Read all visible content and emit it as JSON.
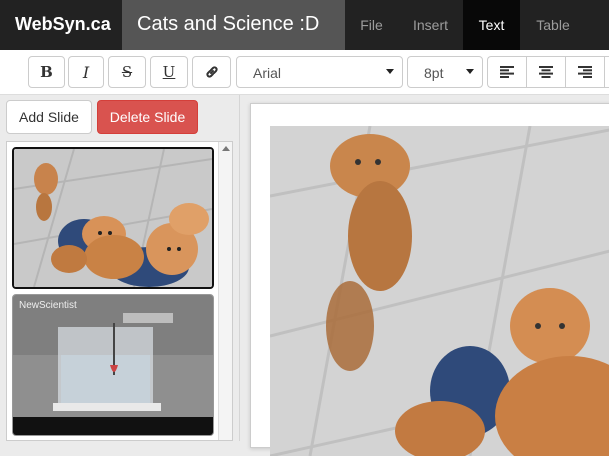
{
  "app": {
    "brand": "WebSyn.ca",
    "doc_title": "Cats and Science :D"
  },
  "menu": {
    "file": "File",
    "insert": "Insert",
    "text": "Text",
    "table": "Table"
  },
  "toolbar": {
    "bold": "B",
    "italic": "I",
    "strike": "S",
    "underline": "U",
    "font_family": "Arial",
    "font_size": "8pt"
  },
  "sidebar": {
    "add_slide": "Add Slide",
    "delete_slide": "Delete Slide",
    "slides": [
      {
        "kind": "photo-kittens"
      },
      {
        "kind": "photo-lab",
        "watermark": "NewScientist"
      }
    ]
  },
  "colors": {
    "topbar": "#222222",
    "active_menu": "#080808",
    "title_bg": "#555555",
    "delete_button": "#d9534f"
  },
  "icons": [
    "link-icon",
    "align-left-icon",
    "align-center-icon",
    "align-right-icon",
    "scroll-up-icon"
  ]
}
